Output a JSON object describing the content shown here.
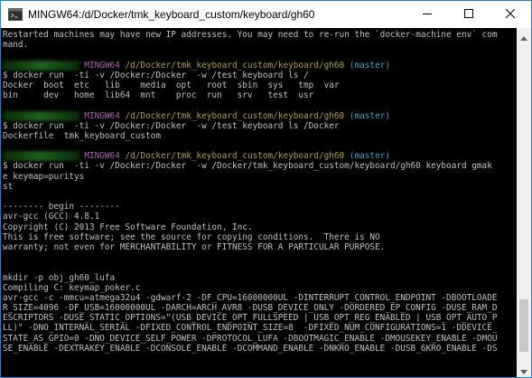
{
  "window": {
    "title": "MINGW64:/d/Docker/tmk_keyboard_custom/keyboard/gh60"
  },
  "terminal": {
    "lines": [
      {
        "type": "text",
        "text": "Restarted machines may have new IP addresses. You may need to re-run the `docker-machine env` com"
      },
      {
        "type": "text",
        "text": "mand."
      },
      {
        "type": "text",
        "text": ""
      },
      {
        "type": "prompt",
        "mingw": "MINGW64",
        "path": "/d/Docker/tmk_keyboard_custom/keyboard/gh60",
        "branch": "(master)"
      },
      {
        "type": "text",
        "text": "$ docker run  -ti -v /Docker:/Docker  -w /test keyboard ls /"
      },
      {
        "type": "text",
        "text": "Docker  boot  etc   lib    media  opt   root  sbin  sys   tmp  var"
      },
      {
        "type": "text",
        "text": "bin     dev   home  lib64  mnt    proc  run   srv   test  usr"
      },
      {
        "type": "text",
        "text": ""
      },
      {
        "type": "prompt",
        "mingw": "MINGW64",
        "path": "/d/Docker/tmk_keyboard_custom/keyboard/gh60",
        "branch": "(master)"
      },
      {
        "type": "text",
        "text": "$ docker run  -ti -v /Docker:/Docker  -w /test keyboard ls /Docker"
      },
      {
        "type": "text",
        "text": "Dockerfile  tmk_keyboard_custom"
      },
      {
        "type": "text",
        "text": ""
      },
      {
        "type": "prompt",
        "mingw": "MINGW64",
        "path": "/d/Docker/tmk_keyboard_custom/keyboard/gh60",
        "branch": "(master)"
      },
      {
        "type": "text",
        "text": "$ docker run  -ti -v /Docker:/Docker  -w /Docker/tmk_keyboard_custom/keyboard/gh60 keyboard gmak"
      },
      {
        "type": "text",
        "text": "e keymap=puritys"
      },
      {
        "type": "text",
        "text": "st"
      },
      {
        "type": "text",
        "text": ""
      },
      {
        "type": "text",
        "text": "-------- begin --------"
      },
      {
        "type": "text",
        "text": "avr-gcc (GCC) 4.8.1"
      },
      {
        "type": "text",
        "text": "Copyright (C) 2013 Free Software Foundation, Inc."
      },
      {
        "type": "text",
        "text": "This is free software; see the source for copying conditions.  There is NO"
      },
      {
        "type": "text",
        "text": "warranty; not even for MERCHANTABILITY or FITNESS FOR A PARTICULAR PURPOSE."
      },
      {
        "type": "text",
        "text": ""
      },
      {
        "type": "text",
        "text": ""
      },
      {
        "type": "text",
        "text": "mkdir -p obj_gh60_lufa"
      },
      {
        "type": "text",
        "text": "Compiling C: keymap_poker.c"
      },
      {
        "type": "text",
        "text": "avr-gcc -c -mmcu=atmega32u4 -gdwarf-2 -DF_CPU=16000000UL -DINTERRUPT_CONTROL_ENDPOINT -DBOOTLOADE"
      },
      {
        "type": "text",
        "text": "R_SIZE=4096 -DF_USB=16000000UL -DARCH=ARCH_AVR8 -DUSB_DEVICE_ONLY -DORDERED_EP_CONFIG -DUSE_RAM_D"
      },
      {
        "type": "text",
        "text": "ESCRIPTORS -DUSE_STATIC_OPTIONS=\"(USB_DEVICE_OPT_FULLSPEED | USB_OPT_REG_ENABLED | USB_OPT_AUTO_P"
      },
      {
        "type": "text",
        "text": "LL)\" -DNO_INTERNAL_SERIAL -DFIXED_CONTROL_ENDPOINT_SIZE=8  -DFIXED_NUM_CONFIGURATIONS=1 -DDEVICE_"
      },
      {
        "type": "text",
        "text": "STATE_AS_GPIO=0 -DNO_DEVICE_SELF_POWER -DPROTOCOL_LUFA -DBOOTMAGIC_ENABLE -DMOUSEKEY_ENABLE -DMOU"
      },
      {
        "type": "text",
        "text": "SE_ENABLE -DEXTRAKEY_ENABLE -DCONSOLE_ENABLE -DCOMMAND_ENABLE -DNKRO_ENABLE -DUSB_6KRO_ENABLE -DS"
      }
    ]
  },
  "icons": {
    "app": "mingw-terminal-icon",
    "minimize": "minimize-icon",
    "maximize": "maximize-icon",
    "close": "close-icon",
    "scroll_up": "scroll-up-arrow-icon",
    "scroll_down": "scroll-down-arrow-icon"
  },
  "colors": {
    "mingw": "#b35fb3",
    "path": "#b0a03a",
    "branch": "#3aa7c8",
    "text": "#c0c0c0"
  }
}
